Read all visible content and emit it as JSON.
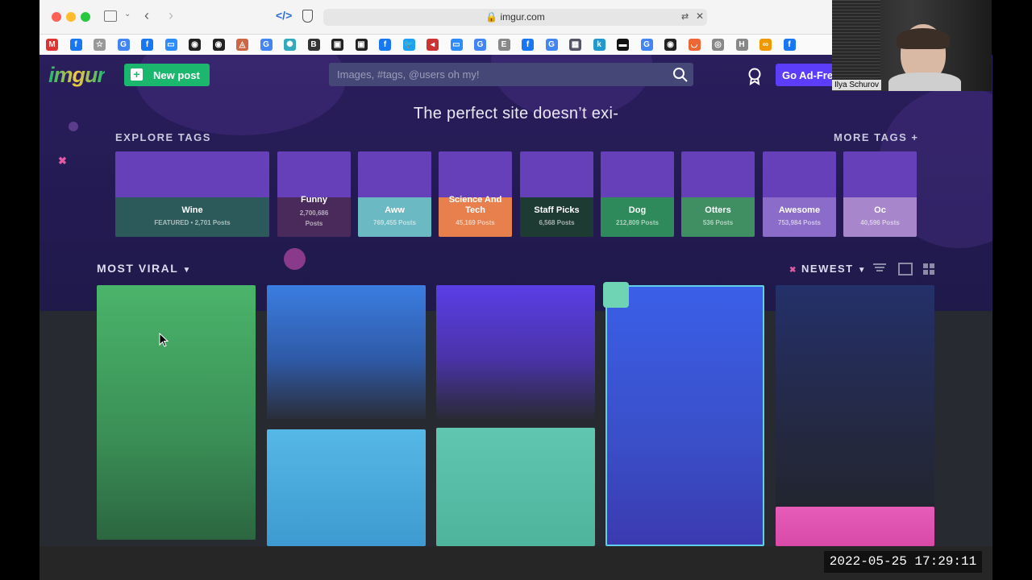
{
  "browser": {
    "url": "imgur.com",
    "bookmark_icons": [
      "M",
      "f",
      "☆",
      "G",
      "f",
      "▭",
      "◉",
      "◉",
      "◬",
      "G",
      "✺",
      "B",
      "▣",
      "▣",
      "f",
      "🐦",
      "◂",
      "▭",
      "G",
      "E",
      "f",
      "G",
      "▦",
      "k",
      "▬",
      "G",
      "◉",
      "◡",
      "◎",
      "H",
      "∞",
      "f"
    ]
  },
  "header": {
    "logo": "imgur",
    "new_post_label": "New post",
    "search_placeholder": "Images, #tags, @users oh my!",
    "go_adfree_label": "Go Ad-Free"
  },
  "hero": {
    "tagline": "The perfect site doesn’t exi-",
    "explore_tags_label": "EXPLORE TAGS",
    "more_tags_label": "MORE TAGS +"
  },
  "tags": [
    {
      "name": "Wine",
      "count": "FEATURED • 2,701 Posts",
      "color": "#2c5a5a"
    },
    {
      "name": "Funny",
      "count_line1": "2,700,686",
      "count_line2": "Posts",
      "color": "#4a2a5a"
    },
    {
      "name": "Aww",
      "count": "769,455 Posts",
      "color": "#6bb9c2"
    },
    {
      "name_line1": "Science And",
      "name_line2": "Tech",
      "count": "45,169 Posts",
      "color": "#e7804d"
    },
    {
      "name": "Staff Picks",
      "count": "6,568 Posts",
      "color": "#1e3b33"
    },
    {
      "name": "Dog",
      "count": "212,809 Posts",
      "color": "#2e8a5a"
    },
    {
      "name": "Otters",
      "count": "536 Posts",
      "color": "#3f8f62"
    },
    {
      "name": "Awesome",
      "count": "753,984 Posts",
      "color": "#8b6dc9"
    },
    {
      "name": "Oc",
      "count": "40,596 Posts",
      "color": "#a786cc"
    }
  ],
  "feed": {
    "sort_label": "MOST VIRAL",
    "order_label": "NEWEST"
  },
  "overlay": {
    "timestamp": "2022-05-25  17:29:11",
    "camera_name": "Ilya Schurov"
  }
}
